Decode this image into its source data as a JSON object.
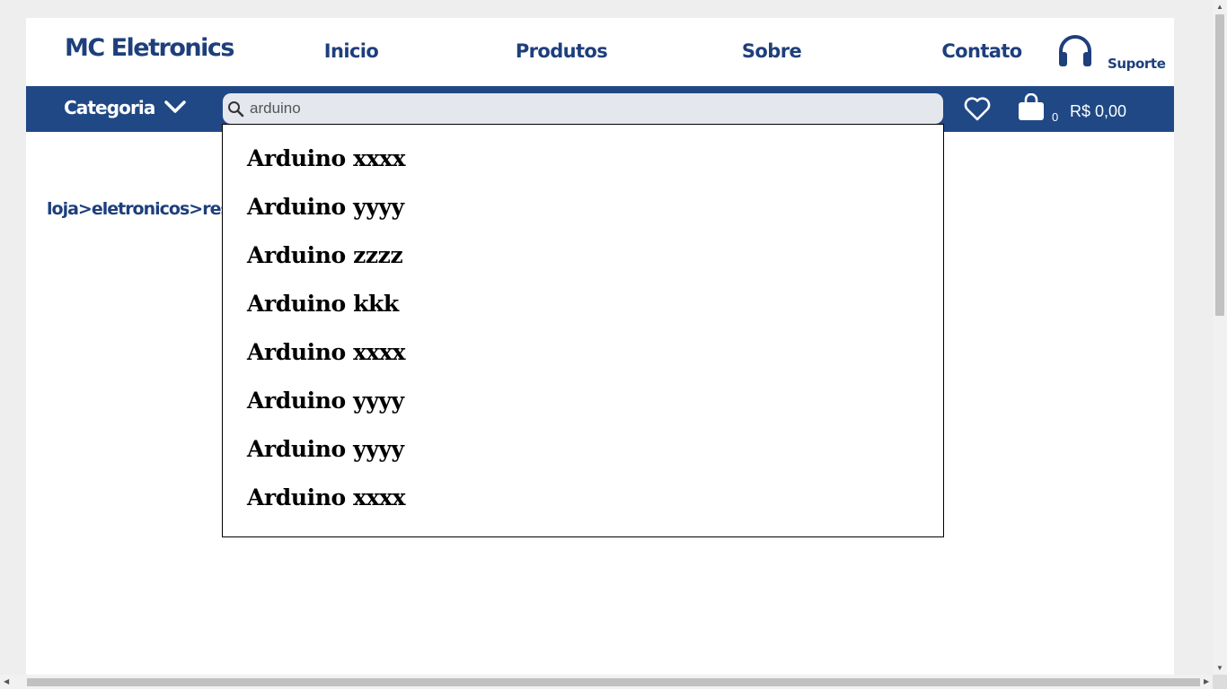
{
  "header": {
    "brand": "MC Eletronics",
    "nav": [
      "Inicio",
      "Produtos",
      "Sobre",
      "Contato"
    ],
    "support_label": "Suporte",
    "support_icon": "headphones-icon"
  },
  "toolbar": {
    "category_label": "Categoria",
    "search_value": "arduino",
    "cart_count": "0",
    "cart_total": "R$ 0,00",
    "brand_color": "#1f4885"
  },
  "breadcrumb": "loja>eletronicos>res",
  "suggestions": [
    "Arduino xxxx",
    "Arduino yyyy",
    "Arduino zzzz",
    "Arduino kkk",
    "Arduino xxxx",
    "Arduino yyyy",
    "Arduino yyyy",
    "Arduino xxxx"
  ]
}
